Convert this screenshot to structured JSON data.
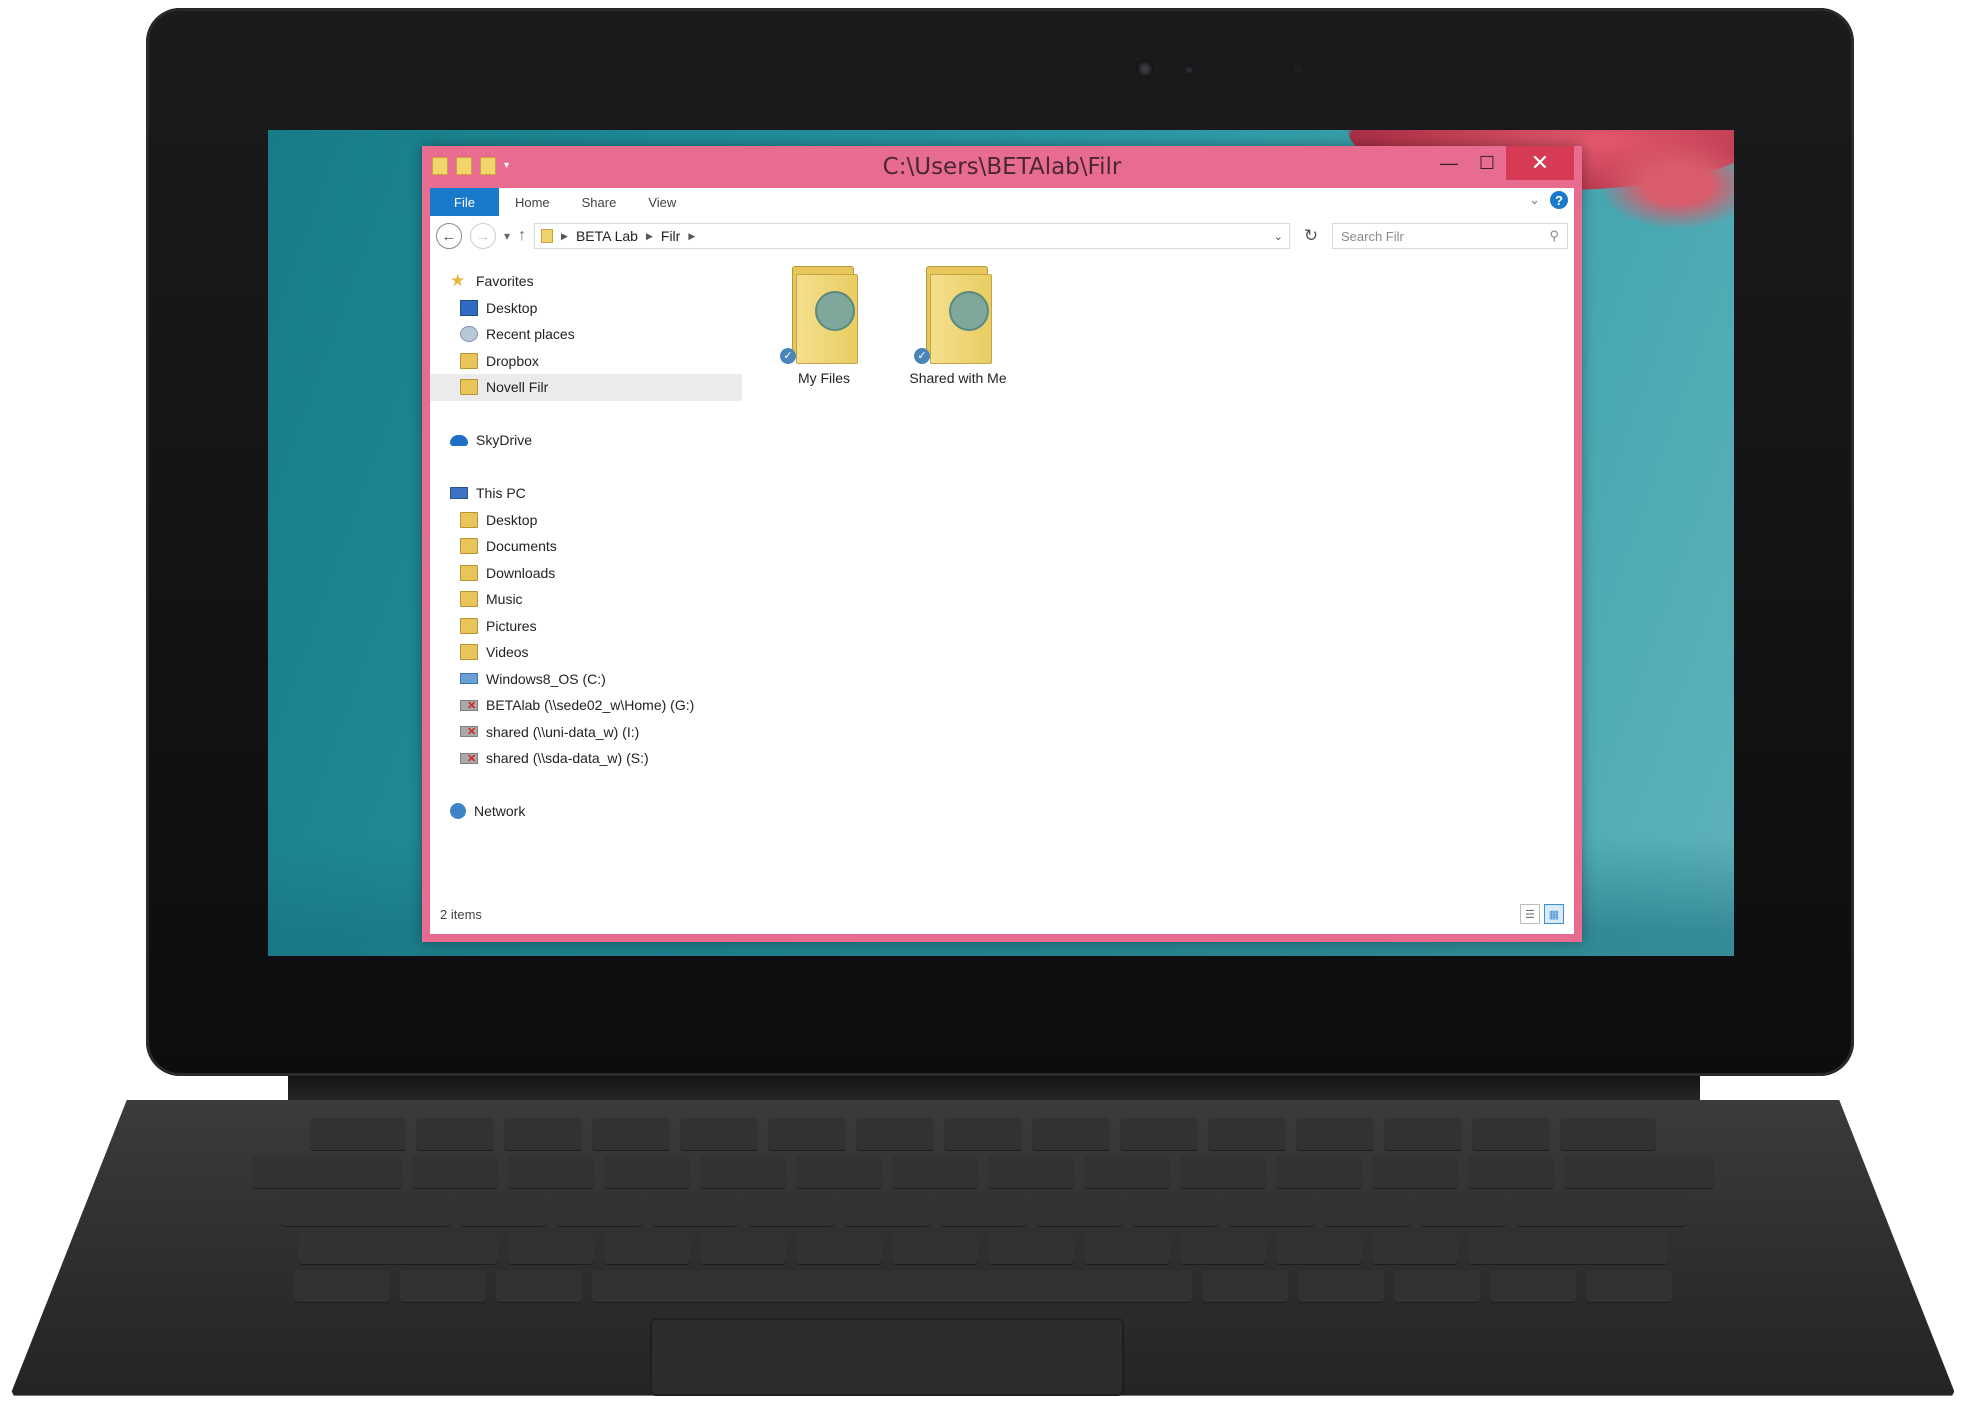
{
  "window": {
    "title": "C:\\Users\\BETAlab\\Filr",
    "minimize_glyph": "—",
    "maximize_glyph": "☐",
    "close_glyph": "✕"
  },
  "ribbon": {
    "tabs": [
      "File",
      "Home",
      "Share",
      "View"
    ],
    "help_glyph": "?",
    "expand_glyph": "⌄"
  },
  "address": {
    "crumbs": [
      "BETA Lab",
      "Filr"
    ],
    "search_placeholder": "Search Filr"
  },
  "nav": {
    "favorites": {
      "label": "Favorites",
      "items": [
        "Desktop",
        "Recent places",
        "Dropbox",
        "Novell Filr"
      ]
    },
    "skydrive": {
      "label": "SkyDrive"
    },
    "this_pc": {
      "label": "This PC",
      "items": [
        "Desktop",
        "Documents",
        "Downloads",
        "Music",
        "Pictures",
        "Videos",
        "Windows8_OS (C:)",
        "BETAlab (\\\\sede02_w\\Home) (G:)",
        "shared (\\\\uni-data_w) (I:)",
        "shared (\\\\sda-data_w) (S:)"
      ]
    },
    "network": {
      "label": "Network"
    }
  },
  "content": {
    "items": [
      "My Files",
      "Shared with Me"
    ]
  },
  "status": {
    "item_count": "2 items"
  }
}
